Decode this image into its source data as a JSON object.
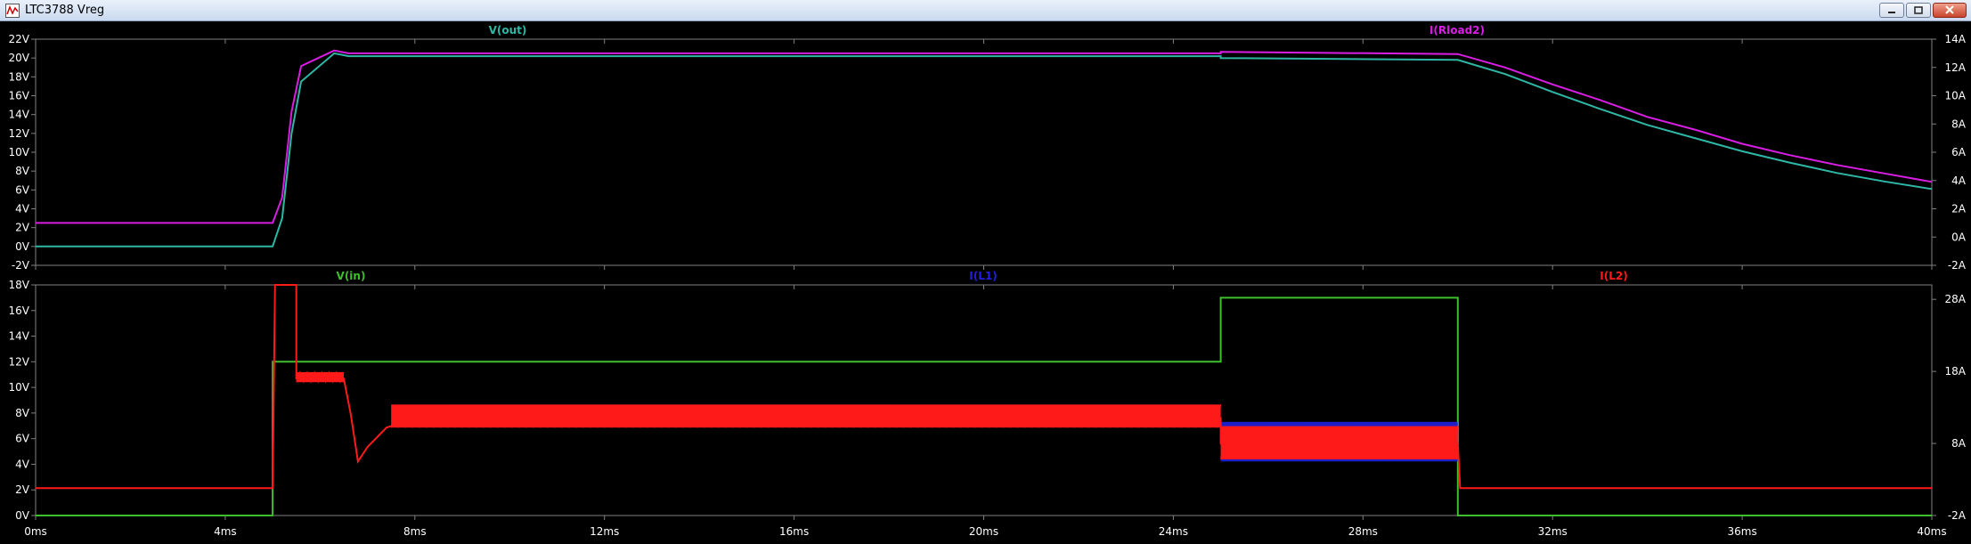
{
  "window": {
    "title": "LTC3788 Vreg",
    "buttons": [
      "minimize",
      "restore",
      "close"
    ]
  },
  "colors": {
    "background": "#000000",
    "grid": "#808080",
    "axis_text": "#ffffff",
    "vout": "#2fb7a6",
    "irload2": "#d81ee3",
    "vin": "#3fbf2e",
    "il1": "#2020e0",
    "il2": "#ff1a1a"
  },
  "chart_data": [
    {
      "type": "line",
      "name": "upper-pane",
      "x": [
        0,
        5,
        5.2,
        5.6,
        6.3,
        6.6,
        25,
        30,
        40
      ],
      "xlabel": "",
      "xlim": [
        0,
        40
      ],
      "x_ticks": [
        "0ms",
        "4ms",
        "8ms",
        "12ms",
        "16ms",
        "20ms",
        "24ms",
        "28ms",
        "32ms",
        "36ms",
        "40ms"
      ],
      "left_axis": {
        "ylim": [
          -2,
          22
        ],
        "ticks": [
          "-2V",
          "0V",
          "2V",
          "4V",
          "6V",
          "8V",
          "10V",
          "12V",
          "14V",
          "16V",
          "18V",
          "20V",
          "22V"
        ]
      },
      "right_axis": {
        "ylim": [
          -2,
          14
        ],
        "ticks": [
          "-2A",
          "0A",
          "2A",
          "4A",
          "6A",
          "8A",
          "10A",
          "12A",
          "14A"
        ]
      },
      "series": [
        {
          "name": "V(out)",
          "axis": "left",
          "points": [
            [
              0,
              0
            ],
            [
              5,
              0
            ],
            [
              5.2,
              3
            ],
            [
              5.4,
              12
            ],
            [
              5.6,
              17.5
            ],
            [
              6.3,
              20.5
            ],
            [
              6.6,
              20.2
            ],
            [
              25,
              20.2
            ],
            [
              25,
              20
            ],
            [
              30,
              19.8
            ],
            [
              31,
              18.3
            ],
            [
              32,
              16.4
            ],
            [
              33,
              14.6
            ],
            [
              34,
              12.9
            ],
            [
              35,
              11.5
            ],
            [
              36,
              10.1
            ],
            [
              37,
              8.9
            ],
            [
              38,
              7.8
            ],
            [
              39,
              6.9
            ],
            [
              40,
              6.1
            ]
          ]
        },
        {
          "name": "I(Rload2)",
          "axis": "right",
          "points": [
            [
              0,
              1
            ],
            [
              5,
              1
            ],
            [
              5.2,
              2.8
            ],
            [
              5.4,
              8.9
            ],
            [
              5.6,
              12.1
            ],
            [
              6.3,
              13.2
            ],
            [
              6.6,
              13
            ],
            [
              25,
              13
            ],
            [
              25,
              13.1
            ],
            [
              30,
              12.95
            ],
            [
              31,
              12
            ],
            [
              32,
              10.8
            ],
            [
              33,
              9.7
            ],
            [
              34,
              8.5
            ],
            [
              35,
              7.6
            ],
            [
              36,
              6.6
            ],
            [
              37,
              5.8
            ],
            [
              38,
              5.1
            ],
            [
              39,
              4.5
            ],
            [
              40,
              3.9
            ]
          ]
        }
      ]
    },
    {
      "type": "line",
      "name": "lower-pane",
      "xlabel": "",
      "xlim": [
        0,
        40
      ],
      "x_ticks": [
        "0ms",
        "4ms",
        "8ms",
        "12ms",
        "16ms",
        "20ms",
        "24ms",
        "28ms",
        "32ms",
        "36ms",
        "40ms"
      ],
      "left_axis": {
        "ylim": [
          0,
          18
        ],
        "ticks": [
          "0V",
          "2V",
          "4V",
          "6V",
          "8V",
          "10V",
          "12V",
          "14V",
          "16V",
          "18V"
        ]
      },
      "right_axis": {
        "ylim": [
          -2,
          30
        ],
        "ticks": [
          "-2A",
          "8A",
          "18A",
          "28A"
        ]
      },
      "series": [
        {
          "name": "V(in)",
          "axis": "left",
          "points": [
            [
              0,
              0
            ],
            [
              5,
              0
            ],
            [
              5,
              12
            ],
            [
              25,
              12
            ],
            [
              25,
              17
            ],
            [
              30,
              17
            ],
            [
              30,
              0
            ],
            [
              40,
              0
            ]
          ]
        },
        {
          "name": "I(L1)",
          "axis": "right",
          "note": "ripple band",
          "bands": [
            {
              "x": [
                25,
                30
              ],
              "low": 5.5,
              "high": 11.0
            }
          ]
        },
        {
          "name": "I(L2)",
          "axis": "right",
          "points": [
            [
              0,
              1.8
            ],
            [
              5,
              1.8
            ],
            [
              5.05,
              30
            ],
            [
              5.5,
              30
            ],
            [
              5.5,
              17
            ],
            [
              6.5,
              17
            ],
            [
              6.65,
              12
            ],
            [
              6.8,
              5.5
            ],
            [
              7,
              7.5
            ],
            [
              7.4,
              10.2
            ],
            [
              8,
              11.5
            ],
            [
              25,
              11.5
            ],
            [
              25,
              8
            ],
            [
              30,
              8
            ],
            [
              30.05,
              1.8
            ],
            [
              40,
              1.8
            ]
          ],
          "bands": [
            {
              "x": [
                5.5,
                6.5
              ],
              "low": 16.5,
              "high": 17.9
            },
            {
              "x": [
                7.5,
                25
              ],
              "low": 10.2,
              "high": 13.4
            },
            {
              "x": [
                25,
                30
              ],
              "low": 5.8,
              "high": 10.4
            }
          ]
        }
      ]
    }
  ]
}
